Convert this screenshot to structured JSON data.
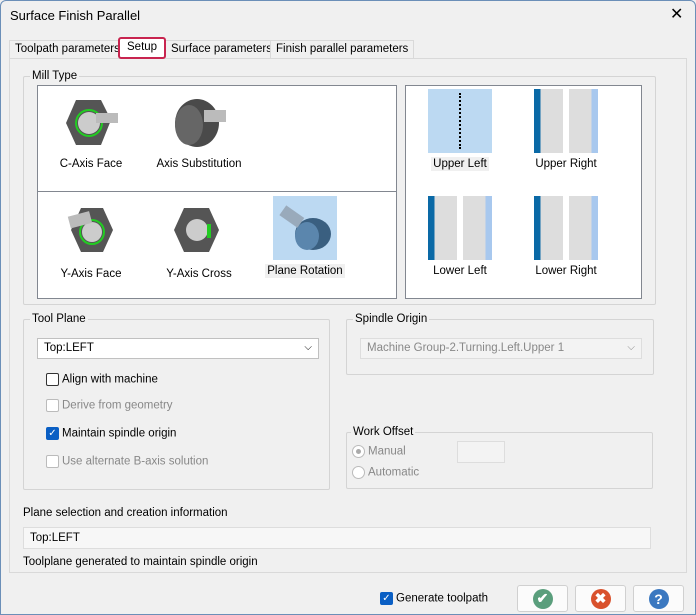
{
  "window": {
    "title": "Surface Finish Parallel",
    "close": "✕"
  },
  "tabs": [
    {
      "label": "Toolpath parameters"
    },
    {
      "label": "Setup"
    },
    {
      "label": "Surface parameters"
    },
    {
      "label": "Finish parallel parameters"
    }
  ],
  "mill_type": {
    "label": "Mill Type",
    "types": [
      {
        "label": "C-Axis Face"
      },
      {
        "label": "Axis Substitution"
      },
      {
        "label": "Y-Axis Face"
      },
      {
        "label": "Y-Axis Cross"
      },
      {
        "label": "Plane Rotation"
      }
    ],
    "positions": [
      {
        "label": "Upper Left"
      },
      {
        "label": "Upper Right"
      },
      {
        "label": "Lower Left"
      },
      {
        "label": "Lower Right"
      }
    ],
    "selected_type": "Plane Rotation",
    "selected_position": "Upper Left"
  },
  "tool_plane": {
    "label": "Tool Plane",
    "value": "Top:LEFT",
    "align": "Align with machine",
    "derive": "Derive from geometry",
    "maintain": "Maintain spindle origin",
    "alternate": "Use alternate B-axis solution"
  },
  "spindle_origin": {
    "label": "Spindle Origin",
    "value": "Machine Group-2.Turning.Left.Upper 1"
  },
  "work_offset": {
    "label": "Work Offset",
    "manual": "Manual",
    "automatic": "Automatic"
  },
  "plane_info": {
    "label": "Plane selection and creation information",
    "value": "Top:LEFT",
    "message": "Toolplane generated to maintain spindle origin"
  },
  "footer": {
    "generate": "Generate toolpath",
    "ok": "✔",
    "cancel": "✖",
    "help": "?"
  },
  "colors": {
    "ok": "#5a9e7c",
    "cancel": "#d9512c",
    "help": "#3b78c0",
    "accent": "#0a5fc4"
  }
}
